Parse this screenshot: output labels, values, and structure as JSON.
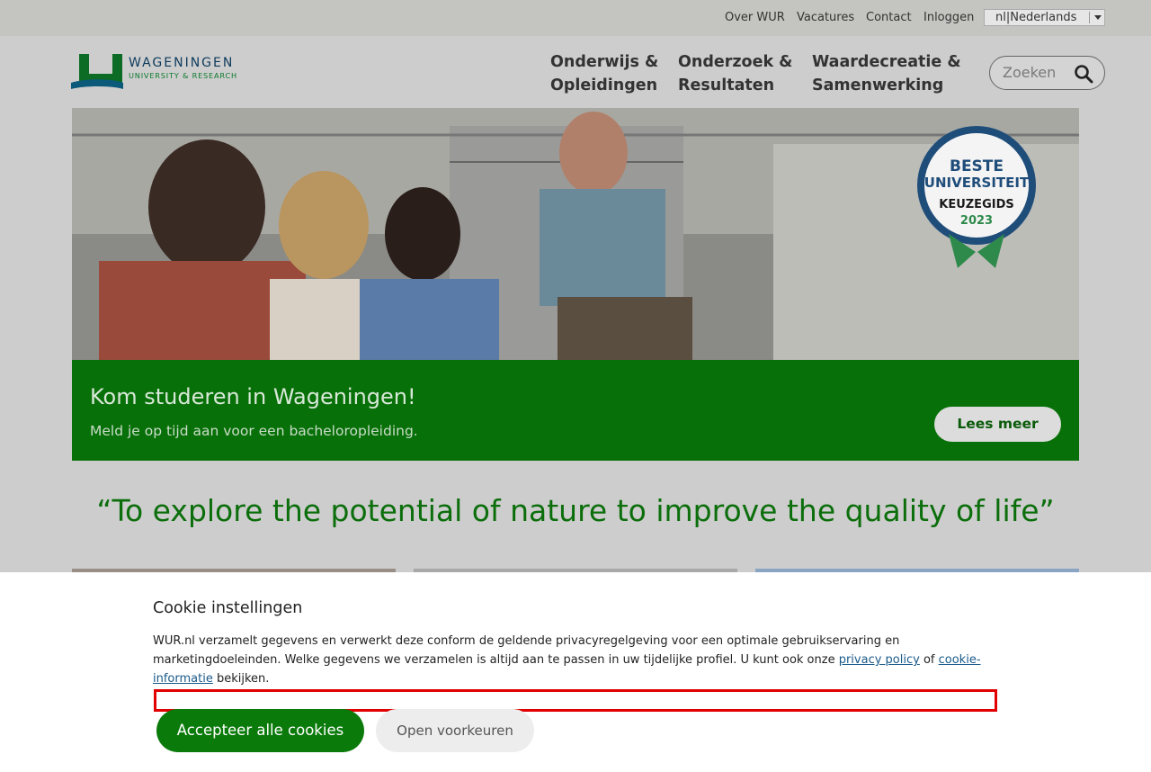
{
  "utility_nav": {
    "links": [
      "Over WUR",
      "Vacatures",
      "Contact",
      "Inloggen"
    ],
    "language": "nl|Nederlands"
  },
  "header": {
    "logo_name": "WAGENINGEN",
    "logo_sub": "UNIVERSITY & RESEARCH",
    "nav": [
      {
        "line1": "Onderwijs &",
        "line2": "Opleidingen"
      },
      {
        "line1": "Onderzoek &",
        "line2": "Resultaten"
      },
      {
        "line1": "Waardecreatie &",
        "line2": "Samenwerking"
      }
    ],
    "search_placeholder": "Zoeken"
  },
  "hero": {
    "badge": {
      "line1": "BESTE",
      "line2": "UNIVERSITEIT",
      "line3": "KEUZEGIDS",
      "line4": "2023"
    },
    "title": "Kom studeren in Wageningen!",
    "subtitle": "Meld je op tijd aan voor een bacheloropleiding.",
    "cta": "Lees meer"
  },
  "quote": "“To explore the potential of nature to improve the quality of life”",
  "cookie": {
    "title": "Cookie instellingen",
    "text_before": "WUR.nl verzamelt gegevens en verwerkt deze conform de geldende privacyregelgeving voor een optimale gebruikservaring en marketingdoeleinden. Welke gegevens we verzamelen is altijd aan te passen in uw tijdelijke profiel. U kunt ook onze ",
    "privacy_link": "privacy policy",
    "text_mid": " of ",
    "info_link": "cookie-informatie",
    "text_after": " bekijken.",
    "accept": "Accepteer alle cookies",
    "prefs": "Open voorkeuren"
  },
  "colors": {
    "brand_green": "#087008",
    "quote_green": "#0b6e0b",
    "focus_outline": "#e00000"
  }
}
